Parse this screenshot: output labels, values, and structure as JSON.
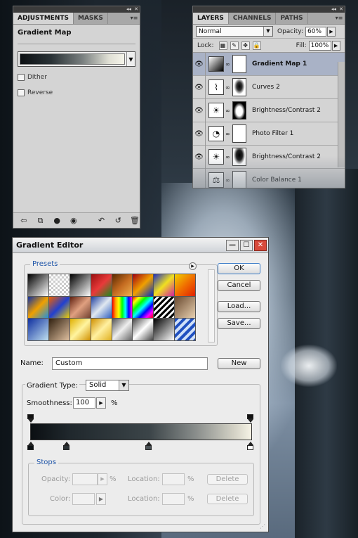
{
  "adjustments_panel": {
    "tabs": [
      "ADJUSTMENTS",
      "MASKS"
    ],
    "title": "Gradient Map",
    "dither_label": "Dither",
    "reverse_label": "Reverse"
  },
  "layers_panel": {
    "tabs": [
      "LAYERS",
      "CHANNELS",
      "PATHS"
    ],
    "blend_mode": "Normal",
    "opacity_label": "Opacity:",
    "opacity_value": "60%",
    "lock_label": "Lock:",
    "fill_label": "Fill:",
    "fill_value": "100%",
    "layers": [
      {
        "name": "Gradient Map 1",
        "icon": "gradient-thumb",
        "selected": true
      },
      {
        "name": "Curves 2",
        "icon": "curves-thumb",
        "selected": false
      },
      {
        "name": "Brightness/Contrast 2",
        "icon": "sun-thumb",
        "selected": false
      },
      {
        "name": "Photo Filter 1",
        "icon": "filter-thumb",
        "selected": false
      },
      {
        "name": "Brightness/Contrast 2",
        "icon": "sun-thumb",
        "selected": false
      },
      {
        "name": "Color Balance 1",
        "icon": "balance-thumb",
        "selected": false
      }
    ]
  },
  "gradient_editor": {
    "title": "Gradient Editor",
    "presets_label": "Presets",
    "buttons": {
      "ok": "OK",
      "cancel": "Cancel",
      "load": "Load...",
      "save": "Save...",
      "new": "New",
      "delete": "Delete"
    },
    "name_label": "Name:",
    "name_value": "Custom",
    "gradient_type_label": "Gradient Type:",
    "gradient_type_value": "Solid",
    "smoothness_label": "Smoothness:",
    "smoothness_value": "100",
    "percent": "%",
    "stops_label": "Stops",
    "opacity_label": "Opacity:",
    "color_label": "Color:",
    "location_label": "Location:"
  }
}
